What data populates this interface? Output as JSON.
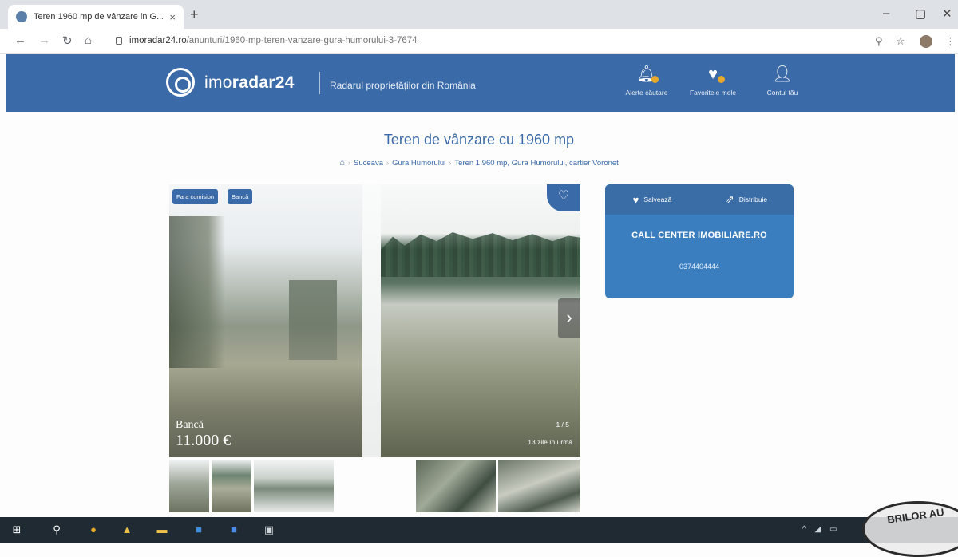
{
  "browser": {
    "tab_title": "Teren 1960 mp de vânzare in G...",
    "tab_close": "×",
    "new_tab": "+",
    "url_domain": "imoradar24.ro",
    "url_path": "/anunturi/1960-mp-teren-vanzare-gura-humorului-3-7674",
    "controls": {
      "minimize": "–",
      "maximize": "▢",
      "close": "✕"
    }
  },
  "site_header": {
    "logo_light": "imo",
    "logo_bold": "radar24",
    "tagline": "Radarul proprietăților din România",
    "nav": [
      {
        "label": "Alerte căutare",
        "icon": "bell-icon"
      },
      {
        "label": "Favoritele mele",
        "icon": "heart-icon"
      },
      {
        "label": "Contul tău",
        "icon": "user-icon"
      }
    ]
  },
  "page": {
    "title": "Teren de vânzare cu 1960 mp",
    "breadcrumb": [
      "Suceava",
      "Gura Humorului",
      "Teren 1 960 mp, Gura Humorului, cartier Voronet"
    ]
  },
  "gallery": {
    "badges": [
      "Fara comision",
      "Bancă"
    ],
    "price_label": "Bancă",
    "price": "11.000 €",
    "counter": "1 / 5",
    "age": "13 zile în urmă"
  },
  "contact": {
    "save_label": "Salvează",
    "share_label": "Distribuie",
    "agency": "CALL CENTER IMOBILIARE.RO",
    "phone": "0374404444"
  },
  "stamp_text": "BRILOR AU",
  "colors": {
    "brand": "#3b6aa8",
    "card": "#3b7ec0",
    "badge_dot": "#e8a92a"
  }
}
